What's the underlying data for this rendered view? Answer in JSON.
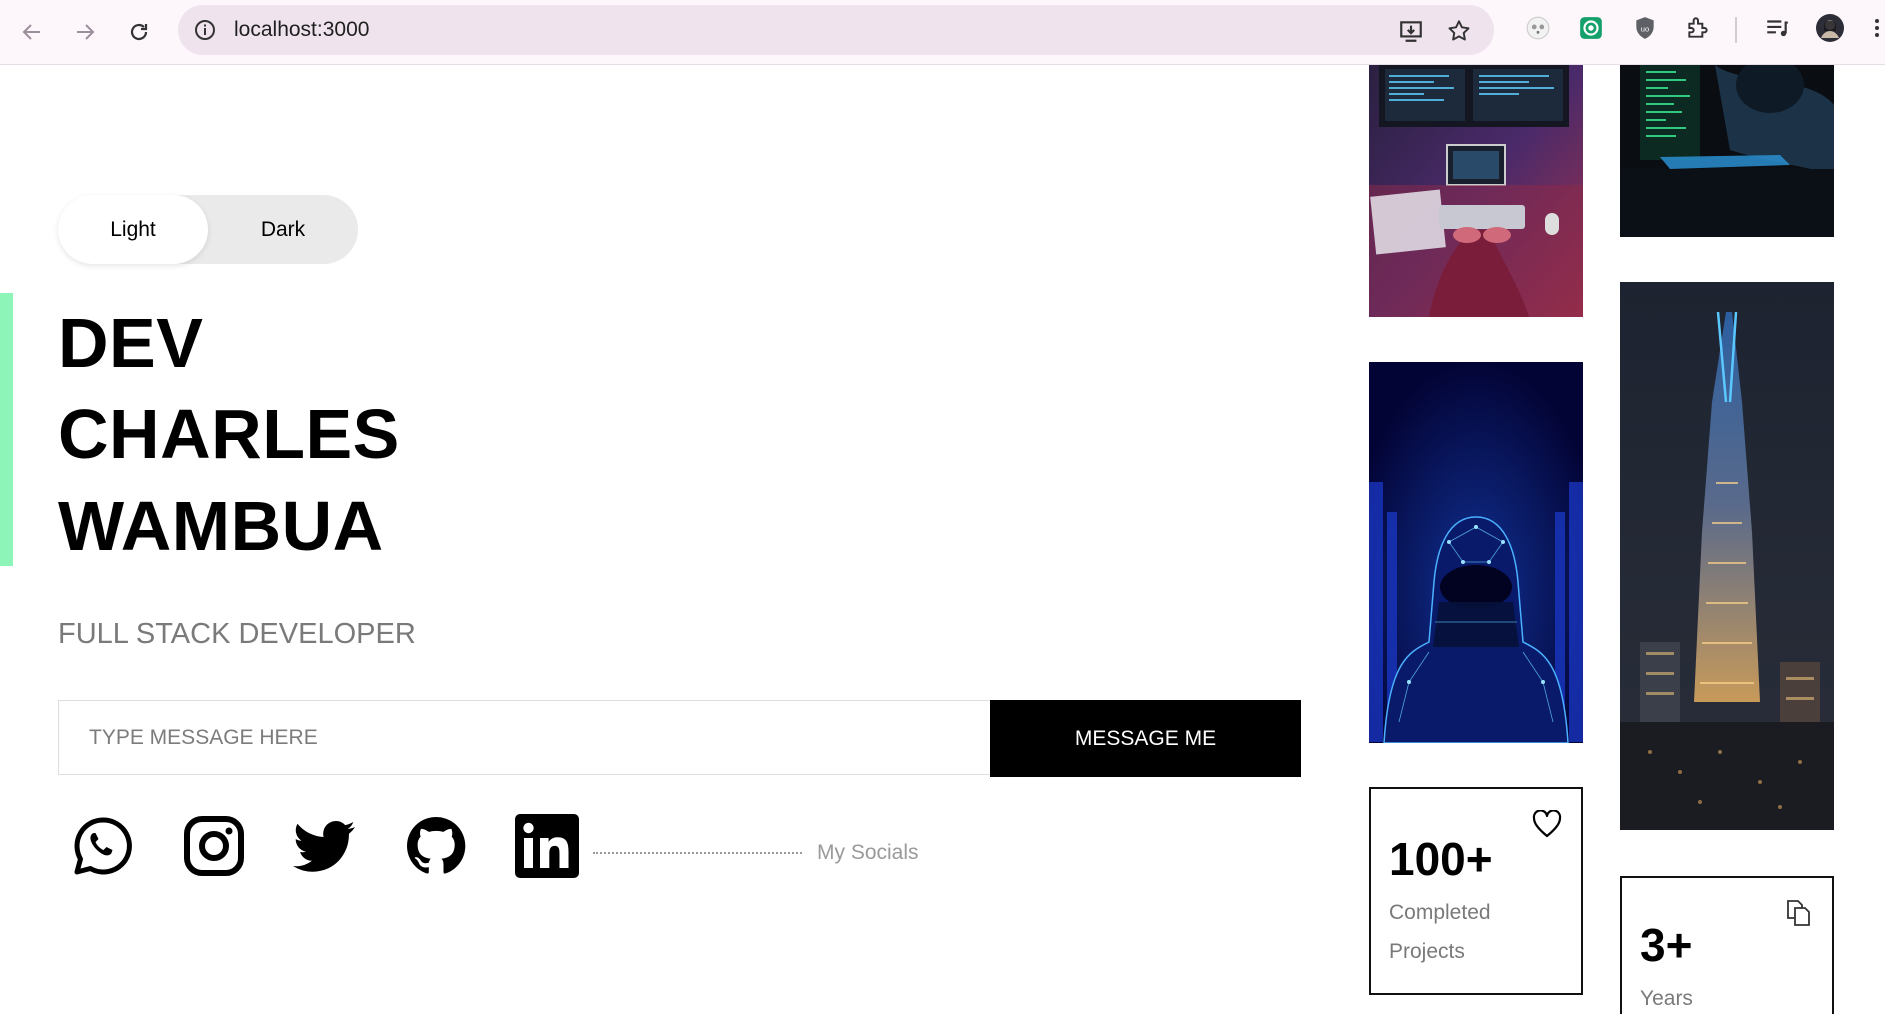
{
  "browser": {
    "url": "localhost:3000",
    "icons": [
      "back-icon",
      "forward-icon",
      "reload-icon",
      "site-info-icon",
      "install-app-icon",
      "bookmark-star-icon",
      "extension-panda-icon",
      "extension-green-icon",
      "extension-shield-icon",
      "extensions-puzzle-icon",
      "media-queue-icon",
      "profile-avatar",
      "menu-dots-icon"
    ]
  },
  "theme_toggle": {
    "light": "Light",
    "dark": "Dark",
    "selected": "Light"
  },
  "hero": {
    "name_lines": [
      "DEV",
      "CHARLES",
      "WAMBUA"
    ],
    "role": "FULL STACK DEVELOPER"
  },
  "message": {
    "placeholder": "TYPE MESSAGE HERE",
    "value": "",
    "button": "MESSAGE ME"
  },
  "socials": {
    "icons": [
      "whatsapp-icon",
      "instagram-icon",
      "twitter-icon",
      "github-icon",
      "linkedin-icon"
    ],
    "label": "My Socials"
  },
  "gallery": {
    "images": [
      "developer-desk-image",
      "hooded-hacker-image",
      "digital-hacker-image",
      "night-skyscraper-image"
    ],
    "stats": [
      {
        "number": "100+",
        "label_line1": "Completed",
        "label_line2": "Projects",
        "icon": "heart-icon"
      },
      {
        "number": "3+",
        "label_line1": "Years",
        "icon": "documents-icon"
      }
    ]
  },
  "colors": {
    "accent": "#8df5b8",
    "button": "#000000",
    "chrome": "#fdf6fb"
  }
}
